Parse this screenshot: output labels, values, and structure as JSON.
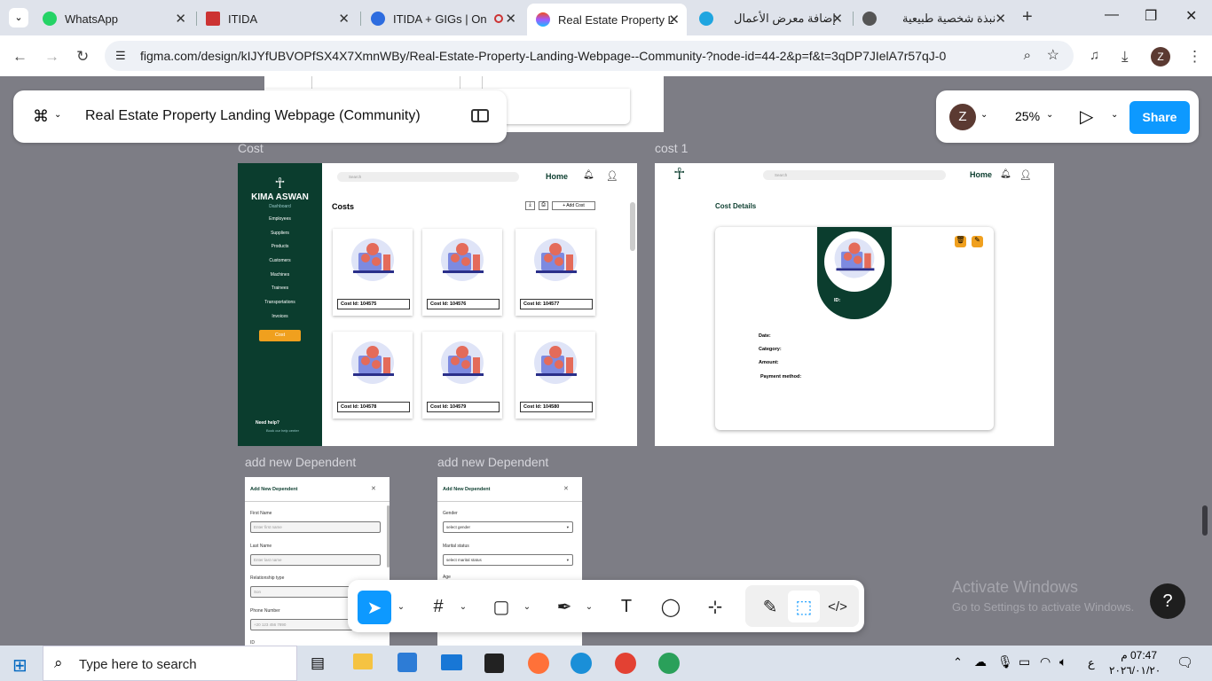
{
  "browser": {
    "tabs": [
      {
        "title": "WhatsApp",
        "icon": "whatsapp-icon"
      },
      {
        "title": "ITIDA",
        "icon": "itida-icon"
      },
      {
        "title": "ITIDA + GIGs | On",
        "icon": "zoom-icon"
      },
      {
        "title": "Real Estate Property L",
        "icon": "figma-icon",
        "active": true
      },
      {
        "title": "إضافة معرض الأعمال",
        "icon": "mostaql-icon"
      },
      {
        "title": "نبذة شخصية طبيعية",
        "icon": "chatgpt-icon"
      }
    ],
    "url": "figma.com/design/kIJYfUBVOPfSX4X7XmnWBy/Real-Estate-Property-Landing-Webpage--Community-?node-id=44-2&p=f&t=3qDP7JIelA7r57qJ-0",
    "profile_initial": "Z"
  },
  "figma": {
    "file_title": "Real Estate Property Landing Webpage (Community)",
    "avatar_initial": "Z",
    "zoom": "25%",
    "share_label": "Share"
  },
  "frames": {
    "cost_label": "Cost",
    "cost1_label": "cost 1",
    "dep1_label": "add new Dependent",
    "dep2_label": "add new Dependent"
  },
  "cost_frame": {
    "brand": "KIMA ASWAN",
    "dashboard": "Dashboard",
    "menu": [
      "Employees",
      "Suppliers",
      "Products",
      "Customers",
      "Machines",
      "Trainees",
      "Transportations",
      "Invoices"
    ],
    "active_btn": "Cost",
    "help": "Need help?",
    "help_sub": "Book our help center",
    "search_placeholder": "Search",
    "home": "Home",
    "page_title": "Costs",
    "add_cost": "+ Add Cost",
    "cards": [
      "Cost Id: 104575",
      "Cost Id: 104576",
      "Cost Id: 104577",
      "Cost Id: 104578",
      "Cost Id: 104579",
      "Cost Id: 104580"
    ]
  },
  "cost1_frame": {
    "search_placeholder": "Search",
    "home": "Home",
    "title": "Cost Details",
    "id_label": "ID:",
    "fields": [
      "Date:",
      "Category:",
      "Amount:",
      "Payment method:"
    ]
  },
  "dep1": {
    "title": "Add New Dependent",
    "labels": [
      "First Name",
      "Last Name",
      "Relationship type",
      "Phone Number",
      "ID"
    ],
    "placeholders": [
      "Enter first name",
      "Enter last name",
      "Son",
      "+20 123 456 7890"
    ]
  },
  "dep2": {
    "title": "Add New Dependent",
    "labels": [
      "Gender",
      "Marital status",
      "Age"
    ],
    "placeholders": [
      "select gender",
      "select marital status"
    ]
  },
  "watermark": {
    "line1": "Activate Windows",
    "line2": "Go to Settings to activate Windows."
  },
  "taskbar": {
    "search_placeholder": "Type here to search",
    "time": "07:47 م",
    "date": "٢٠٢٦/٠١/٢٠",
    "lang": "ع"
  },
  "help_glyph": "?"
}
